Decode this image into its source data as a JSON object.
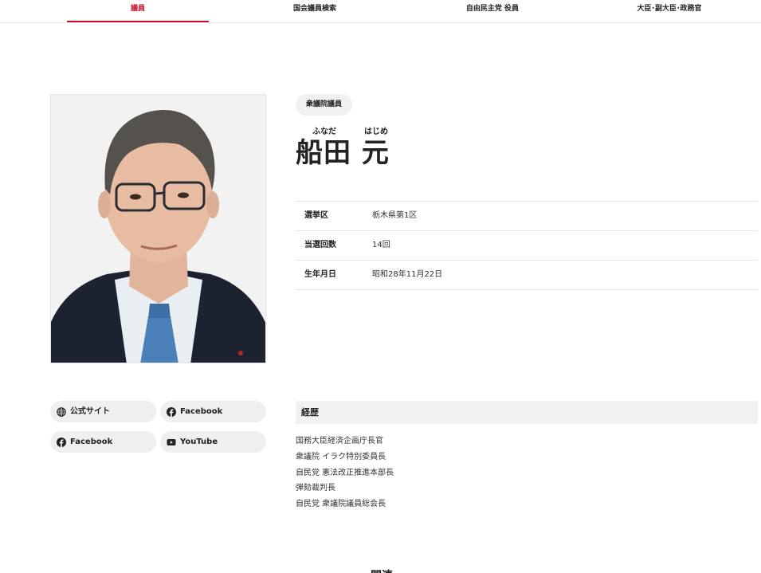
{
  "tabs": [
    {
      "label": "議員",
      "active": true
    },
    {
      "label": "国会議員検索",
      "active": false
    },
    {
      "label": "自由民主党 役員",
      "active": false
    },
    {
      "label": "大臣･副大臣･政務官",
      "active": false
    }
  ],
  "profile": {
    "house": "衆議院議員",
    "family_name": "船田",
    "given_name": "元",
    "family_ruby": "ふなだ",
    "given_ruby": "はじめ",
    "info": [
      {
        "key": "選挙区",
        "value": "栃木県第1区"
      },
      {
        "key": "当選回数",
        "value": "14回"
      },
      {
        "key": "生年月日",
        "value": "昭和28年11月22日"
      }
    ]
  },
  "links": [
    {
      "label": "公式サイト",
      "icon": "globe-icon"
    },
    {
      "label": "Facebook",
      "icon": "facebook-icon"
    },
    {
      "label": "Facebook",
      "icon": "facebook-icon"
    },
    {
      "label": "YouTube",
      "icon": "youtube-icon"
    }
  ],
  "career": {
    "heading": "経歴",
    "items": [
      "国務大臣経済企画庁長官",
      "衆議院 イラク特別委員長",
      "自民党 憲法改正推進本部長",
      "弾劾裁判長",
      "自民党 衆議院議員総会長"
    ]
  },
  "related_heading": "関連",
  "colors": {
    "accent": "#c8102e",
    "pill_bg": "#efefef",
    "section_bg": "#f1f1f1"
  }
}
